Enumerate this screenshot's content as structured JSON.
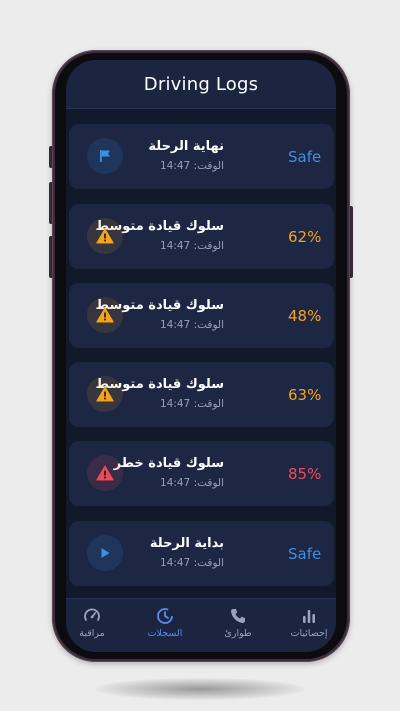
{
  "header": {
    "title": "Driving Logs"
  },
  "colors": {
    "safe": "#3b8fe6",
    "medium": "#f6a21a",
    "danger": "#ef4a5a",
    "accent": "#5b8def"
  },
  "logs": [
    {
      "event": "نهاية الرحلة",
      "time_label": "الوقت:",
      "time": "14:47",
      "score": "Safe",
      "icon": "flag-icon",
      "level": "safe"
    },
    {
      "event": "سلوك قيادة متوسط",
      "time_label": "الوقت:",
      "time": "14:47",
      "score": "62%",
      "icon": "warning-icon",
      "level": "medium"
    },
    {
      "event": "سلوك قيادة متوسط",
      "time_label": "الوقت:",
      "time": "14:47",
      "score": "48%",
      "icon": "warning-icon",
      "level": "medium"
    },
    {
      "event": "سلوك قيادة متوسط",
      "time_label": "الوقت:",
      "time": "14:47",
      "score": "63%",
      "icon": "warning-icon",
      "level": "medium"
    },
    {
      "event": "سلوك قيادة خطر",
      "time_label": "الوقت:",
      "time": "14:47",
      "score": "85%",
      "icon": "warning-icon",
      "level": "danger"
    },
    {
      "event": "بداية الرحلة",
      "time_label": "الوقت:",
      "time": "14:47",
      "score": "Safe",
      "icon": "play-icon",
      "level": "safe"
    }
  ],
  "nav": {
    "items": [
      {
        "label": "مراقبة",
        "icon": "gauge-icon",
        "active": false
      },
      {
        "label": "السجلات",
        "icon": "clock-icon",
        "active": true
      },
      {
        "label": "طوارئ",
        "icon": "phone-icon",
        "active": false
      },
      {
        "label": "إحصائيات",
        "icon": "bar-chart-icon",
        "active": false
      }
    ]
  }
}
